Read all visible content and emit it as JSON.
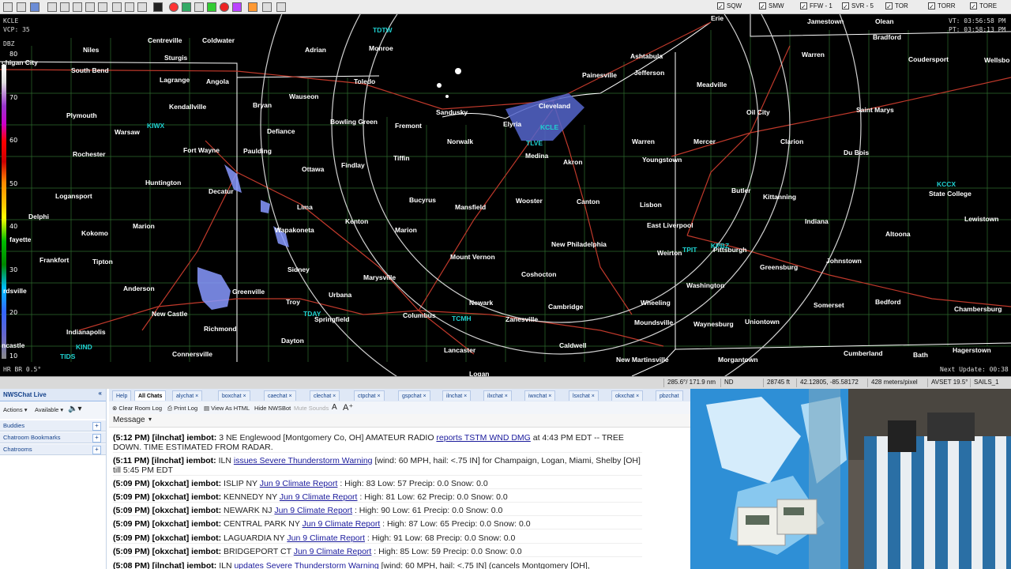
{
  "toolbar": {
    "toggles": [
      "SQW",
      "SMW",
      "FFW - 1",
      "SVR - 5",
      "TOR",
      "TORR",
      "TORE"
    ]
  },
  "radar": {
    "site": "KCLE",
    "vcp": "VCP: 35",
    "product": "DBZ",
    "vt": "VT: 03:56:58 PM",
    "pt": "PT: 03:58:13 PM",
    "next_update": "Next Update: 00:38",
    "product_bottom": "HR BR  0.5°",
    "legend_ticks": [
      "80",
      "70",
      "60",
      "50",
      "40",
      "30",
      "20",
      "10"
    ]
  },
  "cities": [
    "Niles",
    "Centreville",
    "Coldwater",
    "Adrian",
    "Monroe",
    "Olean",
    "Jamestown",
    "Bradford",
    "chigan City",
    "South Bend",
    "Sturgis",
    "Lagrange",
    "Angola",
    "Wauseon",
    "Toledo",
    "Ashtabula",
    "Painesville",
    "Jefferson",
    "Meadville",
    "Warren",
    "Coudersport",
    "Wellsbo",
    "Plymouth",
    "Kendallville",
    "Bryan",
    "Bowling Green",
    "Sandusky",
    "Cleveland",
    "Elyria",
    "Oil City",
    "Saint Marys",
    "Warsaw",
    "Defiance",
    "Fremont",
    "Norwalk",
    "Medina",
    "Akron",
    "Warren",
    "Mercer",
    "Clarion",
    "Du Bois",
    "Rochester",
    "Fort Wayne",
    "Paulding",
    "Findlay",
    "Tiffin",
    "Youngstown",
    "Ottawa",
    "Huntington",
    "Decatur",
    "Butler",
    "Kittanning",
    "State College",
    "Logansport",
    "Lima",
    "Bucyrus",
    "Mansfield",
    "Wooster",
    "Canton",
    "Lisbon",
    "Delphi",
    "Kenton",
    "Indiana",
    "Lewistown",
    "Kokomo",
    "Marion",
    "Wapakoneta",
    "Marion",
    "East Liverpool",
    "fayette",
    "Pittsburgh",
    "Altoona",
    "Frankfort",
    "Tipton",
    "Sidney",
    "Mount Vernon",
    "New Philadelphia",
    "Weirton",
    "Johnstown",
    "Greensburg",
    "Marysville",
    "Coshocton",
    "Anderson",
    "Greenville",
    "Troy",
    "Urbana",
    "Washington",
    "rdsville",
    "New Castle",
    "Newark",
    "Cambridge",
    "Wheeling",
    "Somerset",
    "Bedford",
    "Chambersburg",
    "Richmond",
    "Springfield",
    "Columbus",
    "Zanesville",
    "Waynesburg",
    "Uniontown",
    "Moundsville",
    "Indianapolis",
    "Dayton",
    "Caldwell",
    "Cumberland",
    "Hagerstown",
    "Connersville",
    "Lancaster",
    "New Martinsville",
    "Morgantown",
    "Bath",
    "ncastle",
    "Logan",
    "Erie"
  ],
  "radar_sites": [
    "KIWX",
    "KCLE",
    "TLVE",
    "TDTW",
    "TPIT",
    "KPBZ",
    "KCCX",
    "TDAY",
    "TCMH",
    "KIND",
    "TIDS"
  ],
  "statusbar": {
    "range": "285.6°/ 171.9 nm",
    "value": "ND",
    "height": "28745 ft",
    "latlon": "42.12805, -85.58172",
    "resolution": "428 meters/pixel",
    "avset": "AVSET 19.5°",
    "sails": "SAILS_1"
  },
  "chat": {
    "title": "NWSChat Live",
    "actions": "Actions",
    "status": "Available",
    "sidebar": [
      "Buddies",
      "Chatroom Bookmarks",
      "Chatrooms"
    ],
    "tabs": [
      "Help",
      "All Chats",
      "alychat",
      "boxchat",
      "caechat",
      "clechat",
      "ctpchat",
      "gspchat",
      "ilnchat",
      "ilxchat",
      "iwxchat",
      "lsxchat",
      "okxchat",
      "pbzchat"
    ],
    "tools": [
      "Clear Room Log",
      "Print Log",
      "View As HTML",
      "Hide NWSBot",
      "Mute Sounds"
    ],
    "message_header": "Message",
    "messages": [
      {
        "prefix": "(5:12 PM) [ilnchat] iembot:",
        "pre": "3 NE Englewood [Montgomery Co, OH] AMATEUR RADIO",
        "link": "reports TSTM WND DMG",
        "post": "at 4:43 PM EDT -- TREE DOWN. TIME ESTIMATED FROM RADAR."
      },
      {
        "prefix": "(5:11 PM) [ilnchat] iembot:",
        "pre": "ILN",
        "link": "issues Severe Thunderstorm Warning",
        "post": "[wind: 60 MPH, hail: <.75 IN] for Champaign, Logan, Miami, Shelby [OH] till 5:45 PM EDT"
      },
      {
        "prefix": "(5:09 PM) [okxchat] iembot:",
        "pre": "ISLIP NY",
        "link": "Jun 9 Climate Report",
        "post": ": High: 83 Low: 57 Precip: 0.0 Snow: 0.0"
      },
      {
        "prefix": "(5:09 PM) [okxchat] iembot:",
        "pre": "KENNEDY NY",
        "link": "Jun 9 Climate Report",
        "post": ": High: 81 Low: 62 Precip: 0.0 Snow: 0.0"
      },
      {
        "prefix": "(5:09 PM) [okxchat] iembot:",
        "pre": "NEWARK NJ",
        "link": "Jun 9 Climate Report",
        "post": ": High: 90 Low: 61 Precip: 0.0 Snow: 0.0"
      },
      {
        "prefix": "(5:09 PM) [okxchat] iembot:",
        "pre": "CENTRAL PARK NY",
        "link": "Jun 9 Climate Report",
        "post": ": High: 87 Low: 65 Precip: 0.0 Snow: 0.0"
      },
      {
        "prefix": "(5:09 PM) [okxchat] iembot:",
        "pre": "LAGUARDIA NY",
        "link": "Jun 9 Climate Report",
        "post": ": High: 91 Low: 68 Precip: 0.0 Snow: 0.0"
      },
      {
        "prefix": "(5:09 PM) [okxchat] iembot:",
        "pre": "BRIDGEPORT CT",
        "link": "Jun 9 Climate Report",
        "post": ": High: 85 Low: 59 Precip: 0.0 Snow: 0.0"
      },
      {
        "prefix": "(5:08 PM) [ilnchat] iembot:",
        "pre": "ILN",
        "link": "updates Severe Thunderstorm Warning",
        "post": "[wind: 60 MPH, hail: <.75 IN] (cancels Montgomery [OH],"
      }
    ]
  },
  "colors": {
    "radar_bg": "#000000",
    "county_lines": "#2e6b2e",
    "roads": "#c0392b",
    "site_label": "#1fd1d1",
    "chat_header": "#dfe8f6",
    "link": "#1a1a9c"
  }
}
